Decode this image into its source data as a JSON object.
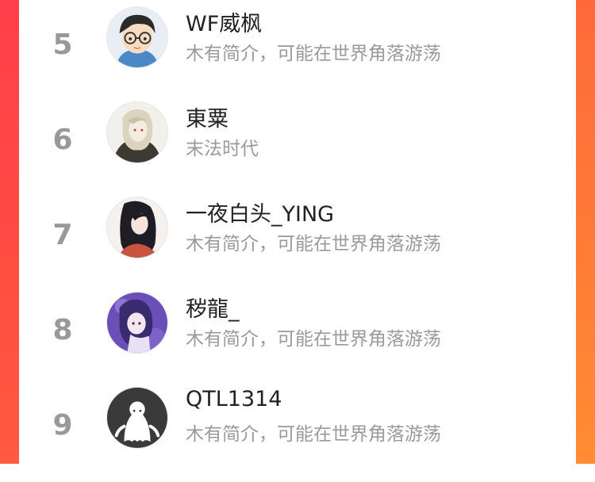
{
  "ranking": {
    "rows": [
      {
        "rank": "5",
        "name": "WF威枫",
        "bio": "木有简介，可能在世界角落游荡",
        "avatar_icon": "avatar-boy-glasses-icon"
      },
      {
        "rank": "6",
        "name": "東粟",
        "bio": "末法时代",
        "avatar_icon": "avatar-anime-girl-icon"
      },
      {
        "rank": "7",
        "name": "一夜白头_YING",
        "bio": "木有简介，可能在世界角落游荡",
        "avatar_icon": "avatar-dark-hair-girl-icon"
      },
      {
        "rank": "8",
        "name": "秽龍_",
        "bio": "木有简介，可能在世界角落游荡",
        "avatar_icon": "avatar-purple-anime-icon"
      },
      {
        "rank": "9",
        "name": "QTL1314",
        "bio": "木有简介，可能在世界角落游荡",
        "avatar_icon": "avatar-default-ghost-icon"
      }
    ]
  },
  "colors": {
    "background_left": "#ff4646",
    "background_right": "#ff7a36",
    "rank_text": "#999999",
    "name_text": "#222222",
    "bio_text": "#9a9a9a"
  }
}
